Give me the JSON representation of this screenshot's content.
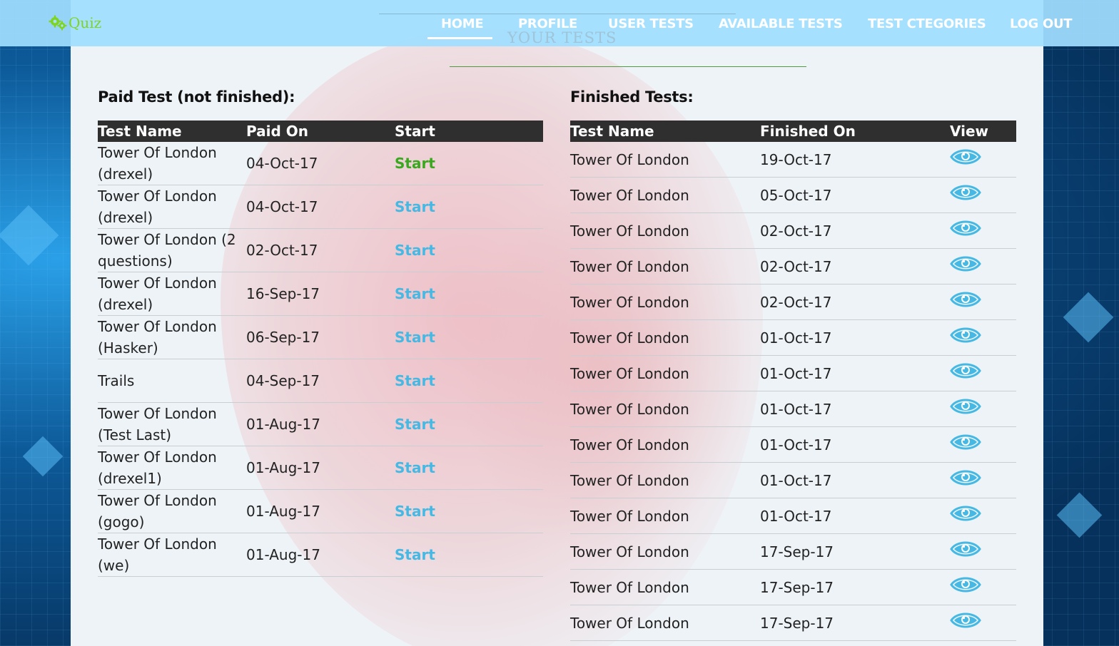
{
  "app": {
    "logo_text": "Quiz"
  },
  "nav": {
    "items": [
      {
        "label": "HOME"
      },
      {
        "label": "PROFILE"
      },
      {
        "label": "USER TESTS"
      },
      {
        "label": "AVAILABLE TESTS"
      },
      {
        "label": "TEST CTEGORIES"
      },
      {
        "label": "LOG OUT"
      }
    ]
  },
  "page_title": "YOUR TESTS",
  "paid": {
    "title": "Paid Test (not finished):",
    "headers": {
      "name": "Test Name",
      "paid_on": "Paid On",
      "start": "Start"
    },
    "rows": [
      {
        "name": "Tower Of London (drexel)",
        "paid_on": "04-Oct-17",
        "action": "Start"
      },
      {
        "name": "Tower Of London (drexel)",
        "paid_on": "04-Oct-17",
        "action": "Start"
      },
      {
        "name": "Tower Of London (2 questions)",
        "paid_on": "02-Oct-17",
        "action": "Start"
      },
      {
        "name": "Tower Of London (drexel)",
        "paid_on": "16-Sep-17",
        "action": "Start"
      },
      {
        "name": "Tower Of London (Hasker)",
        "paid_on": "06-Sep-17",
        "action": "Start"
      },
      {
        "name": "Trails",
        "paid_on": "04-Sep-17",
        "action": "Start"
      },
      {
        "name": "Tower Of London (Test Last)",
        "paid_on": "01-Aug-17",
        "action": "Start"
      },
      {
        "name": "Tower Of London (drexel1)",
        "paid_on": "01-Aug-17",
        "action": "Start"
      },
      {
        "name": "Tower Of London (gogo)",
        "paid_on": "01-Aug-17",
        "action": "Start"
      },
      {
        "name": "Tower Of London (we)",
        "paid_on": "01-Aug-17",
        "action": "Start"
      }
    ]
  },
  "finished": {
    "title": "Finished Tests:",
    "headers": {
      "name": "Test Name",
      "finished_on": "Finished On",
      "view": "View"
    },
    "view_icon": "eye-icon",
    "rows": [
      {
        "name": "Tower Of London",
        "finished_on": "19-Oct-17"
      },
      {
        "name": "Tower Of London",
        "finished_on": "05-Oct-17"
      },
      {
        "name": "Tower Of London",
        "finished_on": "02-Oct-17"
      },
      {
        "name": "Tower Of London",
        "finished_on": "02-Oct-17"
      },
      {
        "name": "Tower Of London",
        "finished_on": "02-Oct-17"
      },
      {
        "name": "Tower Of London",
        "finished_on": "01-Oct-17"
      },
      {
        "name": "Tower Of London",
        "finished_on": "01-Oct-17"
      },
      {
        "name": "Tower Of London",
        "finished_on": "01-Oct-17"
      },
      {
        "name": "Tower Of London",
        "finished_on": "01-Oct-17"
      },
      {
        "name": "Tower Of London",
        "finished_on": "01-Oct-17"
      },
      {
        "name": "Tower Of London",
        "finished_on": "01-Oct-17"
      },
      {
        "name": "Tower Of London",
        "finished_on": "17-Sep-17"
      },
      {
        "name": "Tower Of London",
        "finished_on": "17-Sep-17"
      },
      {
        "name": "Tower Of London",
        "finished_on": "17-Sep-17"
      }
    ]
  },
  "colors": {
    "accent": "#45b9e3",
    "start_active": "#3aa81f",
    "logo": "#7fd321",
    "table_header": "#2f2f2f"
  }
}
